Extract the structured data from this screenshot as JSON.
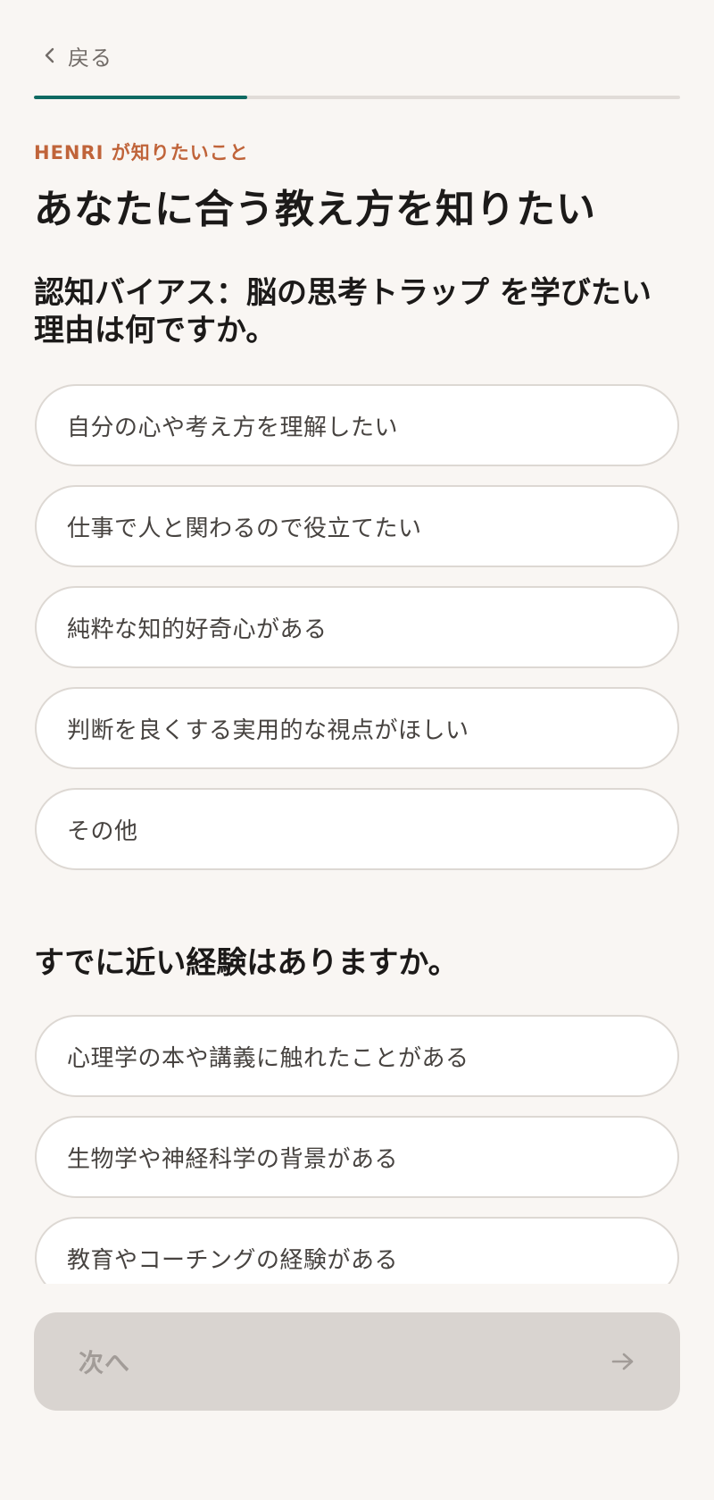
{
  "header": {
    "back_label": "戻る",
    "back_icon": "chevron-left-icon",
    "progress_fraction": 0.33
  },
  "eyebrow": "HENRI が知りたいこと",
  "title": "あなたに合う教え方を知りたい",
  "question1": {
    "text": "認知バイアス：脳の思考トラップ を学びたい理由は何ですか。",
    "options": [
      "自分の心や考え方を理解したい",
      "仕事で人と関わるので役立てたい",
      "純粋な知的好奇心がある",
      "判断を良くする実用的な視点がほしい",
      "その他"
    ]
  },
  "question2": {
    "text": "すでに近い経験はありますか。",
    "options": [
      "心理学の本や講義に触れたことがある",
      "生物学や神経科学の背景がある",
      "教育やコーチングの経験がある"
    ]
  },
  "footer": {
    "next_label": "次へ",
    "next_icon": "arrow-right-icon"
  },
  "colors": {
    "background": "#f9f6f3",
    "accent": "#0f6a62",
    "eyebrow": "#c0643a",
    "disabled_button": "#d9d4d0"
  }
}
